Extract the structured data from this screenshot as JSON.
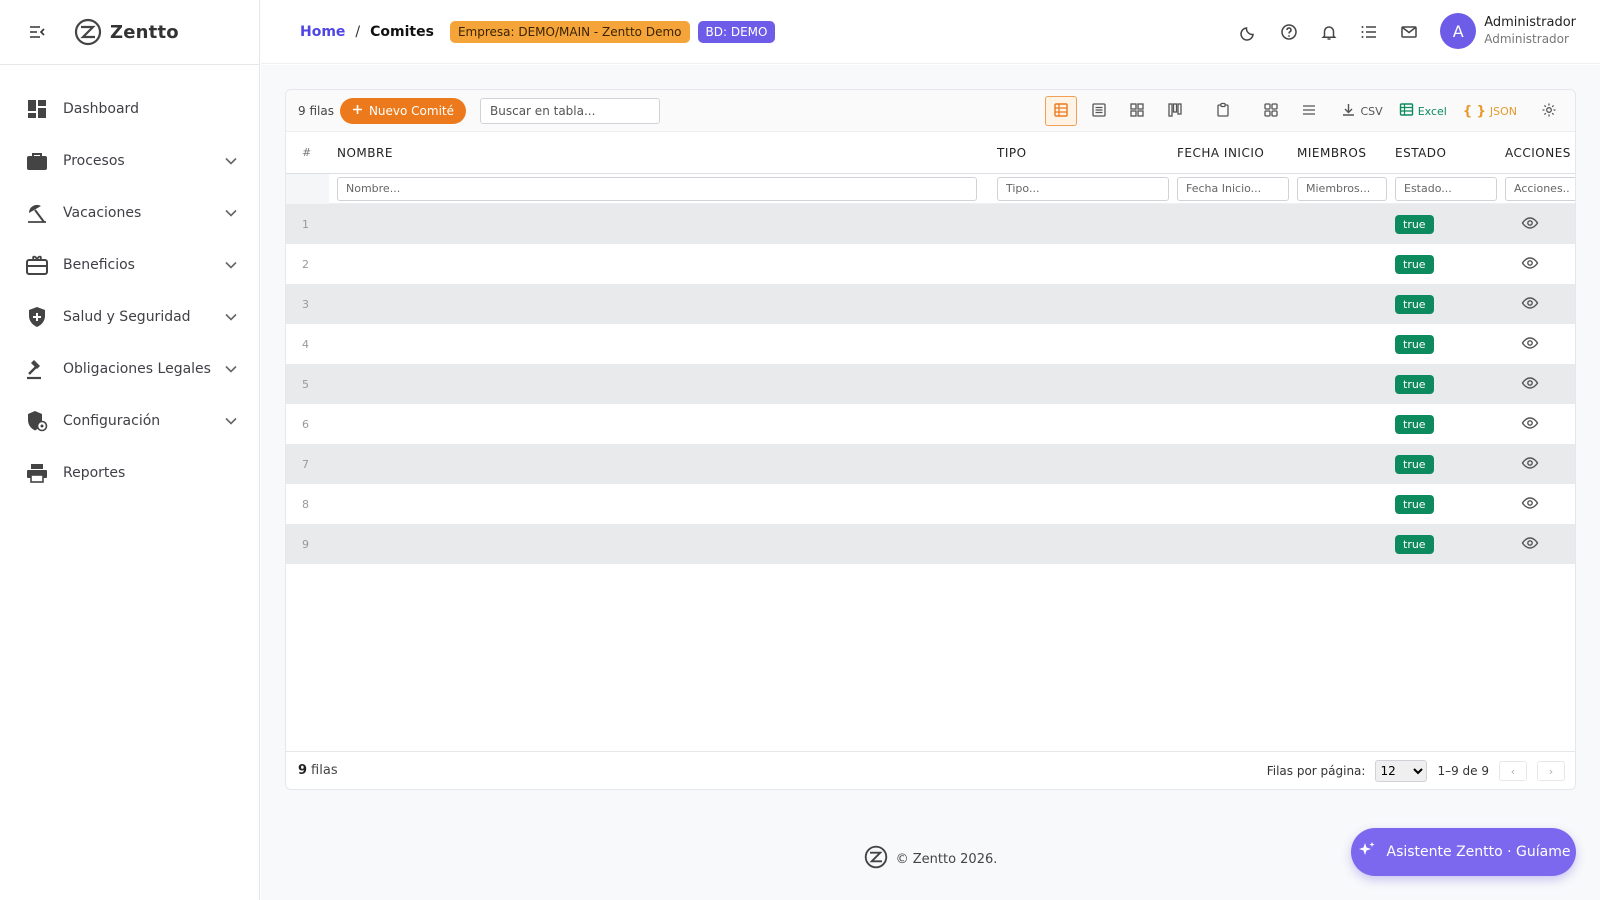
{
  "brand": {
    "name": "Zentto"
  },
  "sidebar": {
    "items": [
      {
        "label": "Dashboard",
        "icon": "dashboard-icon",
        "expandable": false
      },
      {
        "label": "Procesos",
        "icon": "briefcase-icon",
        "expandable": true
      },
      {
        "label": "Vacaciones",
        "icon": "beach-umbrella-icon",
        "expandable": true
      },
      {
        "label": "Beneficios",
        "icon": "gift-card-icon",
        "expandable": true
      },
      {
        "label": "Salud y Seguridad",
        "icon": "shield-plus-icon",
        "expandable": true
      },
      {
        "label": "Obligaciones Legales",
        "icon": "gavel-icon",
        "expandable": true
      },
      {
        "label": "Configuración",
        "icon": "shield-gear-icon",
        "expandable": true
      },
      {
        "label": "Reportes",
        "icon": "printer-icon",
        "expandable": false
      }
    ]
  },
  "header": {
    "breadcrumb_home": "Home",
    "breadcrumb_sep": "/",
    "breadcrumb_current": "Comites",
    "empresa_badge": "Empresa: DEMO/MAIN - Zentto Demo",
    "bd_badge": "BD: DEMO",
    "icons": [
      "moon-icon",
      "help-icon",
      "bell-icon",
      "list-icon",
      "mail-icon"
    ],
    "user": {
      "initial": "A",
      "name": "Administrador",
      "role": "Administrador"
    }
  },
  "toolbar": {
    "rows_label": "9 filas",
    "new_button": "Nuevo Comité",
    "search_placeholder": "Buscar en tabla...",
    "csv_label": "CSV",
    "excel_label": "Excel",
    "json_label": "JSON"
  },
  "table": {
    "columns": {
      "num": "#",
      "nombre": "NOMBRE",
      "tipo": "TIPO",
      "fecha": "FECHA INICIO",
      "miembros": "MIEMBROS",
      "estado": "ESTADO",
      "acciones": "ACCIONES"
    },
    "filters": {
      "nombre": "Nombre...",
      "tipo": "Tipo...",
      "fecha": "Fecha Inicio...",
      "miembros": "Miembros...",
      "estado": "Estado...",
      "acciones": "Acciones..."
    },
    "rows": [
      {
        "num": "1",
        "nombre": "",
        "tipo": "",
        "fecha": "",
        "miembros": "",
        "estado": "true"
      },
      {
        "num": "2",
        "nombre": "",
        "tipo": "",
        "fecha": "",
        "miembros": "",
        "estado": "true"
      },
      {
        "num": "3",
        "nombre": "",
        "tipo": "",
        "fecha": "",
        "miembros": "",
        "estado": "true"
      },
      {
        "num": "4",
        "nombre": "",
        "tipo": "",
        "fecha": "",
        "miembros": "",
        "estado": "true"
      },
      {
        "num": "5",
        "nombre": "",
        "tipo": "",
        "fecha": "",
        "miembros": "",
        "estado": "true"
      },
      {
        "num": "6",
        "nombre": "",
        "tipo": "",
        "fecha": "",
        "miembros": "",
        "estado": "true"
      },
      {
        "num": "7",
        "nombre": "",
        "tipo": "",
        "fecha": "",
        "miembros": "",
        "estado": "true"
      },
      {
        "num": "8",
        "nombre": "",
        "tipo": "",
        "fecha": "",
        "miembros": "",
        "estado": "true"
      },
      {
        "num": "9",
        "nombre": "",
        "tipo": "",
        "fecha": "",
        "miembros": "",
        "estado": "true"
      }
    ]
  },
  "footer": {
    "count_bold": "9",
    "count_text": "filas",
    "per_page_label": "Filas por página:",
    "per_page_value": "12",
    "per_page_options": [
      "12"
    ],
    "range": "1–9 de 9",
    "prev": "‹",
    "next": "›"
  },
  "copyright": "© Zentto 2026.",
  "assistant": {
    "label": "Asistente Zentto · Guíame"
  },
  "colors": {
    "accent": "#ec7a1c",
    "primary": "#6d5ce8",
    "success": "#0d8a5e",
    "link": "#4f46e5"
  }
}
